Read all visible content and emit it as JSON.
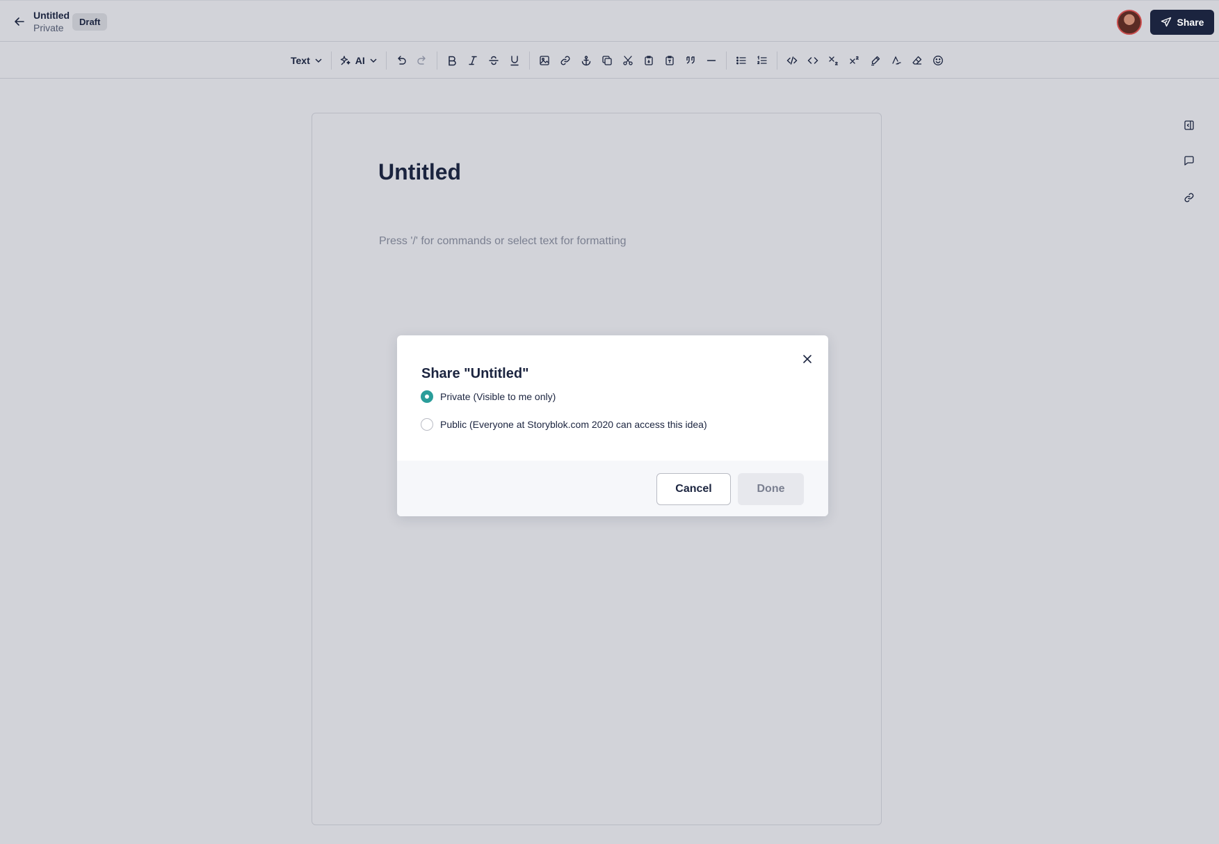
{
  "header": {
    "title": "Untitled",
    "visibility": "Private",
    "badge": "Draft",
    "share_label": "Share"
  },
  "toolbar": {
    "text_style": "Text",
    "ai_label": "AI",
    "icons": [
      "undo-icon",
      "redo-icon",
      "bold-icon",
      "italic-icon",
      "strikethrough-icon",
      "underline-icon",
      "image-icon",
      "link-icon",
      "anchor-icon",
      "copy-icon",
      "cut-icon",
      "paste-icon",
      "clipboard-icon",
      "quote-icon",
      "horizontal-rule-icon",
      "bullet-list-icon",
      "ordered-list-icon",
      "code-block-icon",
      "inline-code-icon",
      "subscript-icon",
      "superscript-icon",
      "highlight-icon",
      "text-color-icon",
      "clear-format-icon",
      "emoji-icon"
    ]
  },
  "sidebar_icons": [
    "collapse-panel-icon",
    "comment-icon",
    "link-icon"
  ],
  "editor": {
    "title": "Untitled",
    "placeholder": "Press '/' for commands or select text for formatting"
  },
  "modal": {
    "title": "Share \"Untitled\"",
    "options": [
      {
        "label": "Private (Visible to me only)",
        "selected": true
      },
      {
        "label": "Public (Everyone at Storyblok.com 2020 can access this idea)",
        "selected": false
      }
    ],
    "cancel_label": "Cancel",
    "done_label": "Done"
  },
  "colors": {
    "accent": "#2a9d9a",
    "primary_dark": "#1b243f",
    "backdrop": "#d2d3d9"
  }
}
